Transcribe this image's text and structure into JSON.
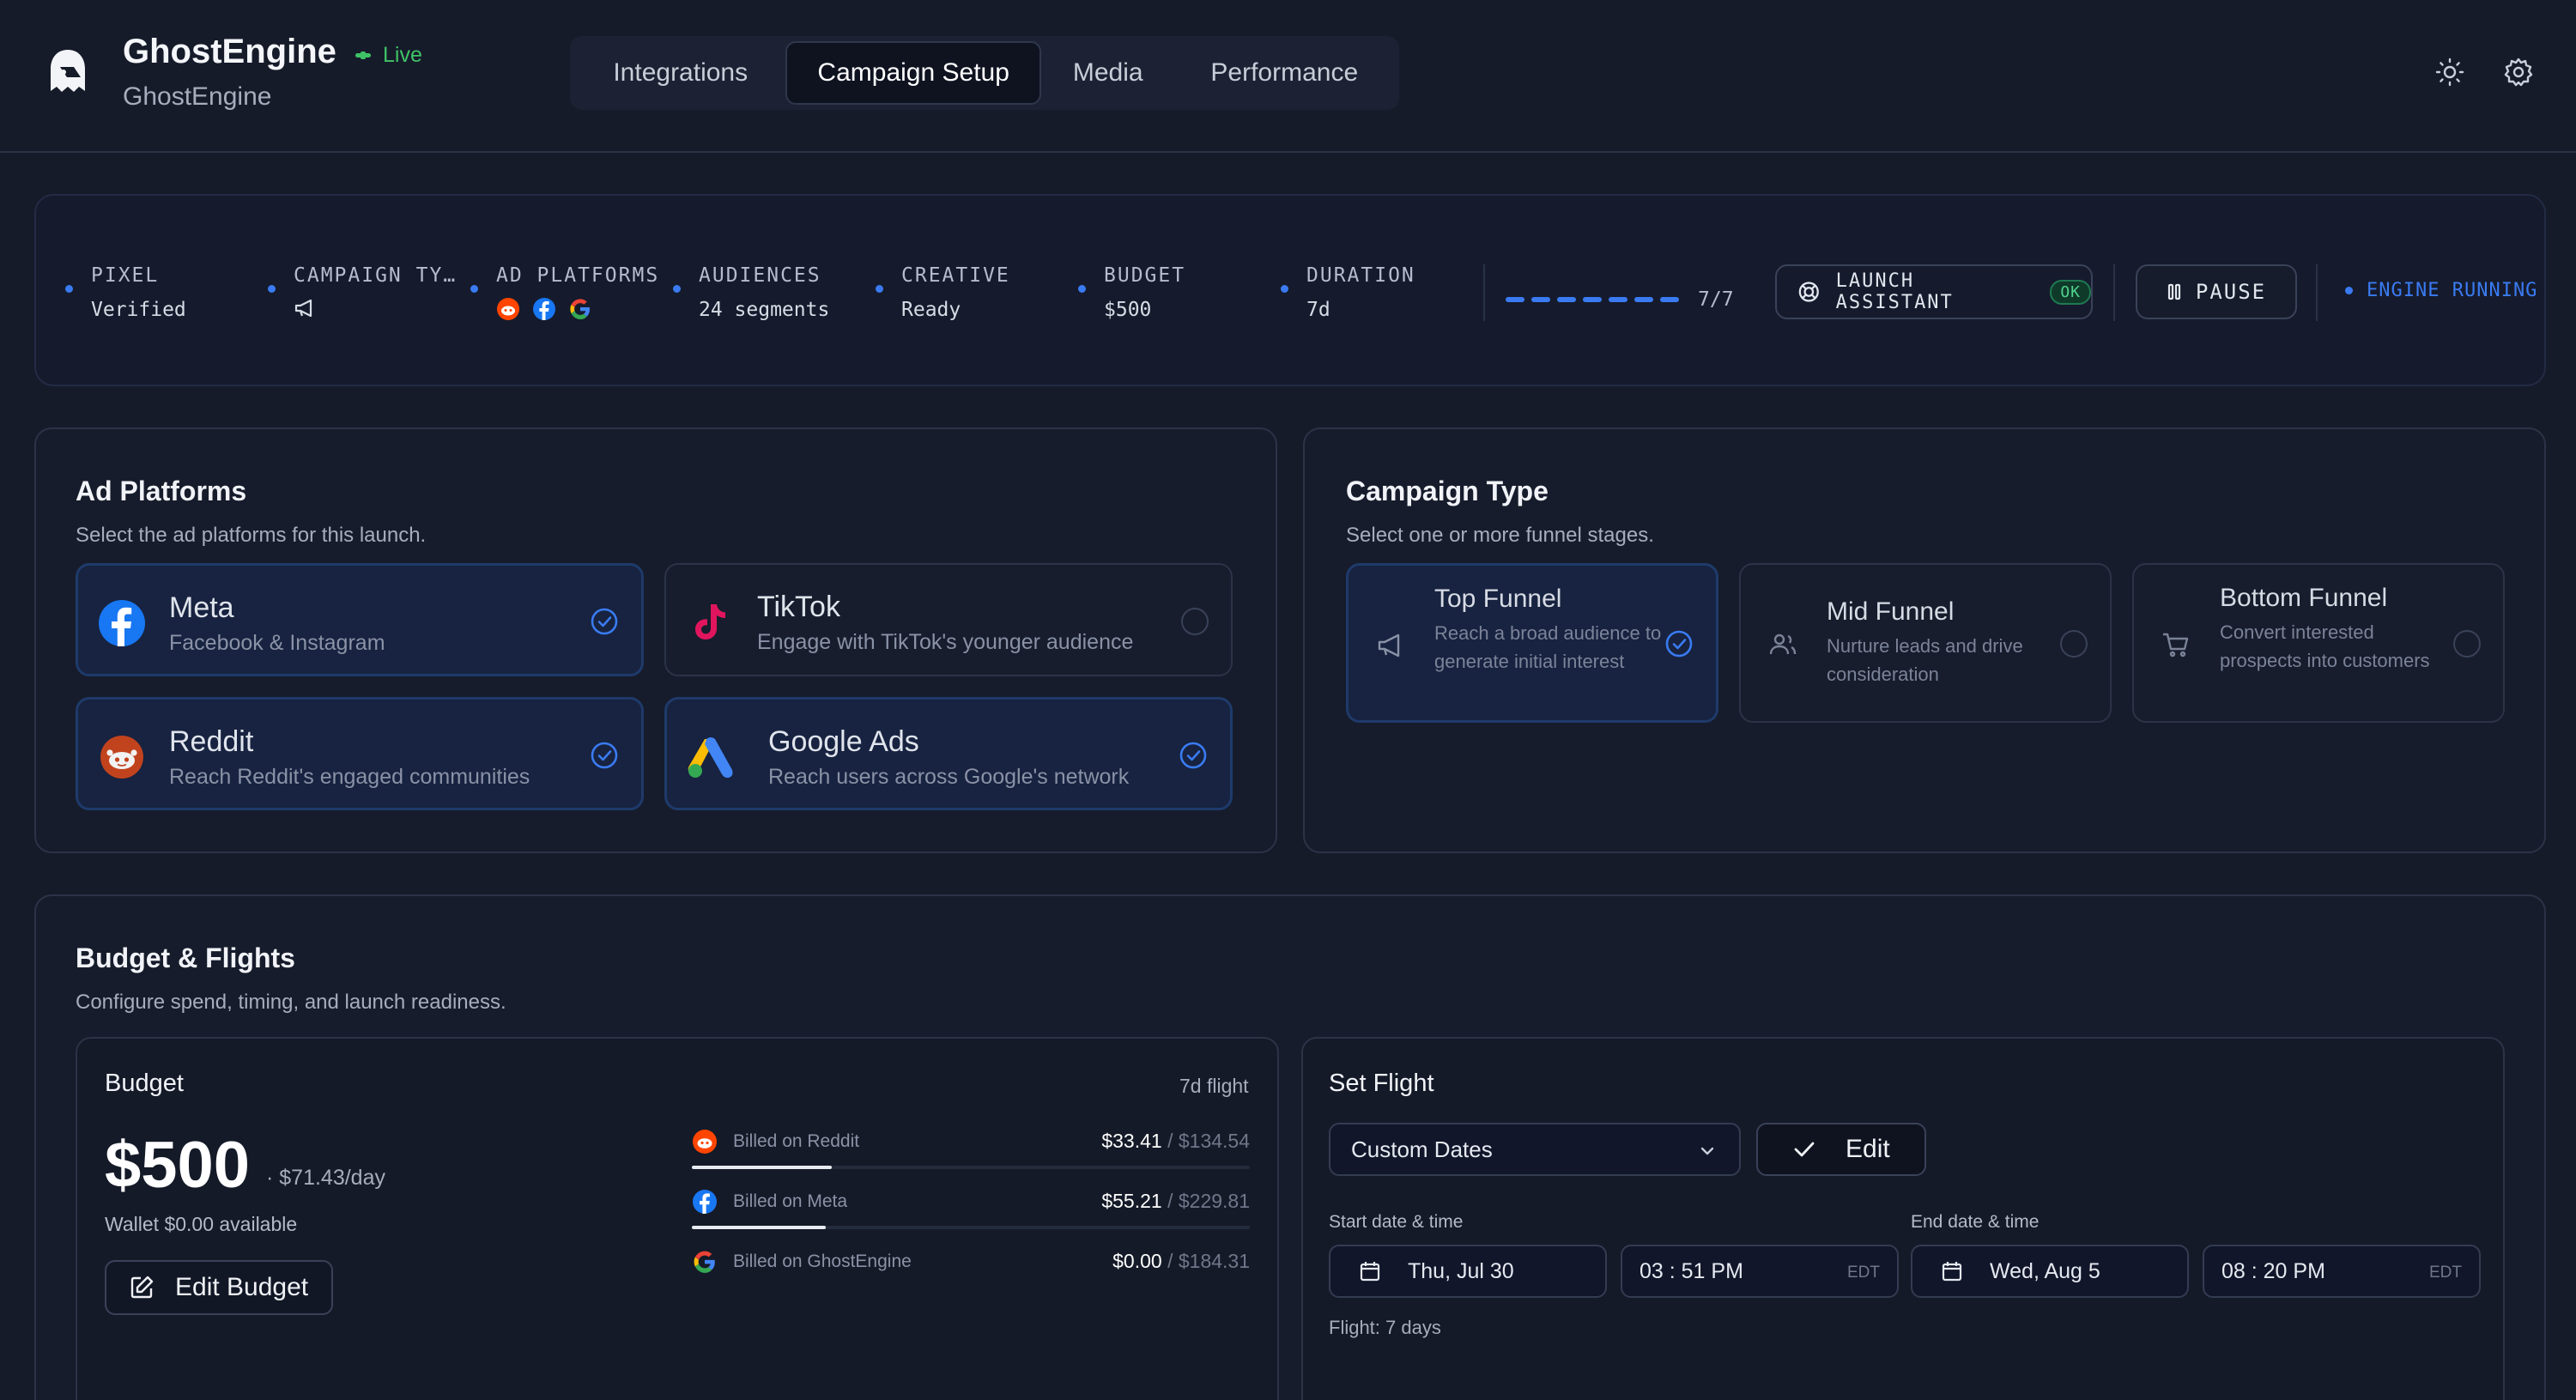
{
  "header": {
    "title": "GhostEngine",
    "subtitle": "GhostEngine",
    "live_label": "Live",
    "tabs": [
      {
        "label": "Integrations"
      },
      {
        "label": "Campaign Setup"
      },
      {
        "label": "Media"
      },
      {
        "label": "Performance"
      }
    ],
    "active_tab": "Campaign Setup"
  },
  "status": {
    "steps": [
      {
        "label": "PIXEL",
        "value": "Verified"
      },
      {
        "label": "CAMPAIGN TY…",
        "value": ""
      },
      {
        "label": "AD PLATFORMS",
        "value": ""
      },
      {
        "label": "AUDIENCES",
        "value": "24 segments"
      },
      {
        "label": "CREATIVE",
        "value": "Ready"
      },
      {
        "label": "BUDGET",
        "value": "$500"
      },
      {
        "label": "DURATION",
        "value": "7d"
      }
    ],
    "progress_count": "7/7",
    "progress_fraction": 1.0,
    "launch_assistant_label": "LAUNCH ASSISTANT",
    "launch_assistant_status": "OK",
    "pause_label": "PAUSE",
    "engine_status": "ENGINE RUNNING"
  },
  "ad_platforms": {
    "title": "Ad Platforms",
    "subtitle": "Select the ad platforms for this launch.",
    "options": [
      {
        "name": "Meta",
        "desc": "Facebook & Instagram",
        "selected": true,
        "icon": "meta-icon"
      },
      {
        "name": "TikTok",
        "desc": "Engage with TikTok's younger audience",
        "selected": false,
        "icon": "tiktok-icon"
      },
      {
        "name": "Reddit",
        "desc": "Reach Reddit's engaged communities",
        "selected": true,
        "icon": "reddit-icon"
      },
      {
        "name": "Google Ads",
        "desc": "Reach users across Google's network",
        "selected": true,
        "icon": "google-ads-icon"
      }
    ]
  },
  "campaign_type": {
    "title": "Campaign Type",
    "subtitle": "Select one or more funnel stages.",
    "options": [
      {
        "name": "Top Funnel",
        "desc": "Reach a broad audience to generate initial interest",
        "selected": true,
        "icon": "megaphone-icon"
      },
      {
        "name": "Mid Funnel",
        "desc": "Nurture leads and drive consideration",
        "selected": false,
        "icon": "users-icon"
      },
      {
        "name": "Bottom Funnel",
        "desc": "Convert interested prospects into customers",
        "selected": false,
        "icon": "cart-icon"
      }
    ]
  },
  "budget_flights": {
    "title": "Budget & Flights",
    "subtitle": "Configure spend, timing, and launch readiness.",
    "budget": {
      "title": "Budget",
      "flight_note": "7d flight",
      "amount": "$500",
      "per_day": "· $71.43/day",
      "wallet": "Wallet $0.00 available",
      "edit_label": "Edit Budget",
      "billing": [
        {
          "label": "Billed on Reddit",
          "spent": "$33.41",
          "total": "/ $134.54",
          "fraction": 0.25,
          "icon": "reddit-icon"
        },
        {
          "label": "Billed on Meta",
          "spent": "$55.21",
          "total": "/ $229.81",
          "fraction": 0.24,
          "icon": "meta-icon"
        },
        {
          "label": "Billed on GhostEngine",
          "spent": "$0.00",
          "total": "/ $184.31",
          "fraction": 0.0,
          "icon": "google-icon"
        }
      ]
    },
    "flight": {
      "title": "Set Flight",
      "mode": "Custom Dates",
      "edit_label": "Edit",
      "start_label": "Start date & time",
      "end_label": "End date & time",
      "start_date": "Thu, Jul 30",
      "start_time": "03 : 51  PM",
      "end_date": "Wed, Aug 5",
      "end_time": "08 : 20  PM",
      "timezone": "EDT",
      "flight_days": "Flight: 7 days"
    }
  },
  "colors": {
    "accent": "#3a7bf2",
    "live": "#3fc266",
    "background": "#161b2a"
  }
}
